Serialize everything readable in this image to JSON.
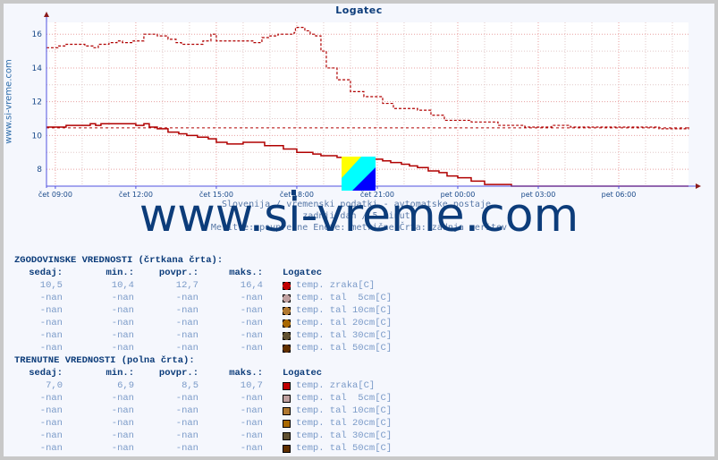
{
  "title": "Logatec",
  "side_label": "www.si-vreme.com",
  "watermark": "www.si-vreme.com",
  "info_lines": [
    "Slovenija / vremenski podatki - avtomatske postaje.",
    "zadnji dan / 5 minut.",
    "Meritve: povprečne  Enote: metrične  Črta: zadnja meritev"
  ],
  "colors": {
    "series": "#b00000",
    "axis": "#5050e0",
    "grid": "#e8a0a0",
    "title": "#0c3c7a"
  },
  "chart_data": {
    "type": "line",
    "title": "Logatec",
    "xlabel": "",
    "ylabel": "",
    "x_unit": "hours since čet 09:00",
    "xlim": [
      -0.33,
      23.6
    ],
    "ylim": [
      7,
      16.7
    ],
    "yticks": [
      8,
      10,
      12,
      14,
      16
    ],
    "xticks": [
      {
        "x": 0,
        "label": "čet 09:00"
      },
      {
        "x": 3,
        "label": "čet 12:00"
      },
      {
        "x": 6,
        "label": "čet 15:00"
      },
      {
        "x": 9,
        "label": "čet 18:00"
      },
      {
        "x": 12,
        "label": "čet 21:00"
      },
      {
        "x": 15,
        "label": "pet 00:00"
      },
      {
        "x": 18,
        "label": "pet 03:00"
      },
      {
        "x": 21,
        "label": "pet 06:00"
      }
    ],
    "grid": true,
    "reference_lines": [
      {
        "name": "historical average level",
        "y": 10.45,
        "style": "dashed"
      },
      {
        "name": "current min level",
        "y": 7.0,
        "style": "dashed"
      }
    ],
    "series": [
      {
        "name": "temp. zraka [C] (zgodovinske, črtkana)",
        "style": "dashed",
        "x": [
          -0.33,
          0.1,
          0.4,
          0.6,
          1.1,
          1.4,
          1.6,
          2.0,
          2.3,
          2.5,
          2.9,
          3.0,
          3.3,
          3.6,
          3.8,
          4.2,
          4.5,
          4.7,
          5.5,
          5.8,
          6.0,
          6.5,
          6.8,
          7.4,
          7.7,
          8.0,
          8.3,
          8.6,
          8.9,
          8.95,
          9.1,
          9.3,
          9.5,
          9.7,
          9.9,
          10.1,
          10.5,
          11.0,
          11.5,
          12.2,
          12.6,
          13.0,
          13.5,
          14.0,
          14.5,
          15.5,
          16.5,
          17.5,
          18.5,
          19.0,
          19.2,
          19.5,
          20.5,
          21.5,
          22.5,
          23.0,
          23.6
        ],
        "y": [
          15.2,
          15.3,
          15.4,
          15.4,
          15.3,
          15.2,
          15.4,
          15.5,
          15.6,
          15.5,
          15.6,
          15.6,
          16.0,
          16.0,
          15.9,
          15.7,
          15.5,
          15.4,
          15.6,
          16.0,
          15.6,
          15.6,
          15.6,
          15.5,
          15.8,
          15.9,
          16.0,
          16.0,
          16.1,
          16.4,
          16.4,
          16.2,
          16.0,
          15.9,
          15.0,
          14.0,
          13.3,
          12.6,
          12.3,
          11.9,
          11.6,
          11.6,
          11.5,
          11.2,
          10.9,
          10.8,
          10.6,
          10.5,
          10.6,
          10.6,
          10.5,
          10.5,
          10.5,
          10.5,
          10.4,
          10.4,
          10.5
        ]
      },
      {
        "name": "temp. zraka [C] (trenutne, polna)",
        "style": "solid",
        "x": [
          -0.33,
          0.4,
          1.3,
          1.5,
          1.7,
          2.4,
          3.0,
          3.3,
          3.5,
          3.8,
          4.2,
          4.6,
          4.9,
          5.3,
          5.7,
          6.0,
          6.4,
          7.0,
          7.4,
          7.8,
          8.5,
          9.0,
          9.6,
          9.9,
          10.3,
          10.5,
          10.8,
          11.0,
          11.4,
          11.8,
          12.2,
          12.5,
          12.9,
          13.2,
          13.5,
          13.9,
          14.3,
          14.6,
          15.0,
          15.5,
          16.0,
          17.0,
          18.0,
          19.0,
          20.0,
          21.0,
          22.0,
          23.6
        ],
        "y": [
          10.5,
          10.6,
          10.7,
          10.6,
          10.7,
          10.7,
          10.6,
          10.7,
          10.5,
          10.4,
          10.2,
          10.1,
          10.0,
          9.9,
          9.8,
          9.6,
          9.5,
          9.6,
          9.6,
          9.4,
          9.2,
          9.0,
          8.9,
          8.8,
          8.8,
          8.7,
          8.7,
          8.7,
          8.6,
          8.6,
          8.5,
          8.4,
          8.3,
          8.2,
          8.1,
          7.9,
          7.8,
          7.6,
          7.5,
          7.3,
          7.1,
          7.0,
          7.0,
          7.0,
          7.0,
          7.0,
          7.0,
          7.0
        ]
      }
    ]
  },
  "historical": {
    "section_title": "ZGODOVINSKE VREDNOSTI (črtkana črta):",
    "headers": [
      "sedaj:",
      "min.:",
      "povpr.:",
      "maks.:",
      "Logatec"
    ],
    "rows": [
      {
        "now": "10,5",
        "min": "10,4",
        "avg": "12,7",
        "max": "16,4",
        "label": "temp. zraka[C]",
        "color": "#c00000"
      },
      {
        "now": "-nan",
        "min": "-nan",
        "avg": "-nan",
        "max": "-nan",
        "label": "temp. tal  5cm[C]",
        "color": "#c0a0a0"
      },
      {
        "now": "-nan",
        "min": "-nan",
        "avg": "-nan",
        "max": "-nan",
        "label": "temp. tal 10cm[C]",
        "color": "#b07830"
      },
      {
        "now": "-nan",
        "min": "-nan",
        "avg": "-nan",
        "max": "-nan",
        "label": "temp. tal 20cm[C]",
        "color": "#a86800"
      },
      {
        "now": "-nan",
        "min": "-nan",
        "avg": "-nan",
        "max": "-nan",
        "label": "temp. tal 30cm[C]",
        "color": "#605030"
      },
      {
        "now": "-nan",
        "min": "-nan",
        "avg": "-nan",
        "max": "-nan",
        "label": "temp. tal 50cm[C]",
        "color": "#603000"
      }
    ]
  },
  "current": {
    "section_title": "TRENUTNE VREDNOSTI (polna črta):",
    "headers": [
      "sedaj:",
      "min.:",
      "povpr.:",
      "maks.:",
      "Logatec"
    ],
    "rows": [
      {
        "now": "7,0",
        "min": "6,9",
        "avg": "8,5",
        "max": "10,7",
        "label": "temp. zraka[C]",
        "color": "#c00000"
      },
      {
        "now": "-nan",
        "min": "-nan",
        "avg": "-nan",
        "max": "-nan",
        "label": "temp. tal  5cm[C]",
        "color": "#c0a0a0"
      },
      {
        "now": "-nan",
        "min": "-nan",
        "avg": "-nan",
        "max": "-nan",
        "label": "temp. tal 10cm[C]",
        "color": "#b07830"
      },
      {
        "now": "-nan",
        "min": "-nan",
        "avg": "-nan",
        "max": "-nan",
        "label": "temp. tal 20cm[C]",
        "color": "#a86800"
      },
      {
        "now": "-nan",
        "min": "-nan",
        "avg": "-nan",
        "max": "-nan",
        "label": "temp. tal 30cm[C]",
        "color": "#605030"
      },
      {
        "now": "-nan",
        "min": "-nan",
        "avg": "-nan",
        "max": "-nan",
        "label": "temp. tal 50cm[C]",
        "color": "#603000"
      }
    ]
  }
}
